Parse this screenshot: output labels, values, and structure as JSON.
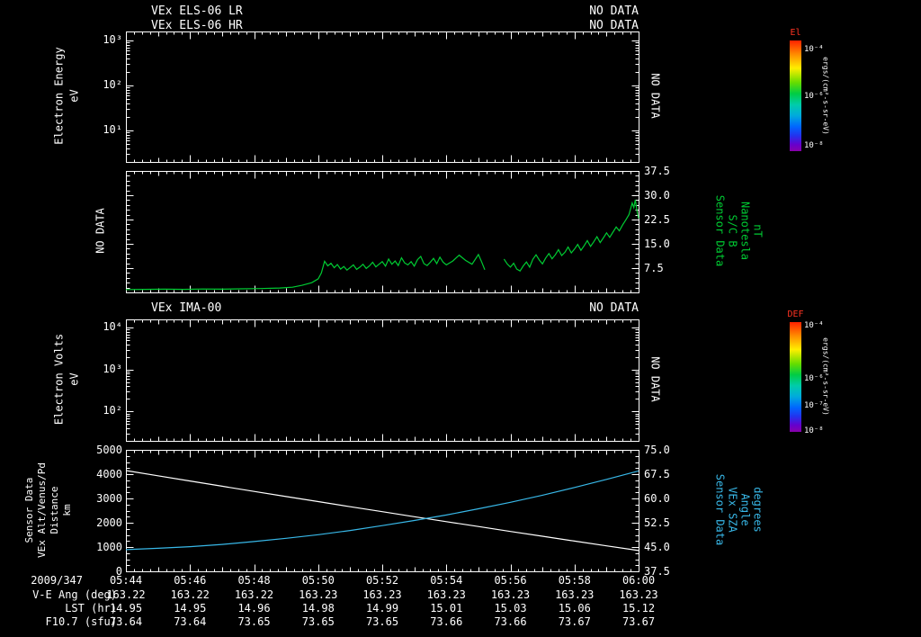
{
  "colors": {
    "background": "#000000",
    "axis": "#ffffff",
    "mag_line": "#00cc33",
    "alt_line": "#ffffff",
    "sza_line": "#38b8e8",
    "green_label": "#00cc33",
    "cyan_label": "#38b8e8",
    "colorbar_title": "#ff3322"
  },
  "panels": {
    "els": {
      "title_lr": "VEx ELS-06 LR",
      "no_data_lr": "NO DATA",
      "title_hr": "VEx ELS-06 HR",
      "no_data_hr": "NO DATA",
      "ylabel_line1": "Electron Energy",
      "ylabel_line2": "eV",
      "yticks": [
        "10³",
        "10²",
        "10¹"
      ],
      "right_label": "NO DATA"
    },
    "mag": {
      "left_label": "NO DATA",
      "yticks_right": [
        "37.5",
        "30.0",
        "22.5",
        "15.0",
        "7.5"
      ],
      "right_label_lines": [
        "Sensor Data",
        "S/C B",
        "Nanotesla",
        "nT"
      ]
    },
    "ima": {
      "title": "VEx IMA-00",
      "no_data": "NO DATA",
      "ylabel_line1": "Electron Volts",
      "ylabel_line2": "eV",
      "yticks": [
        "10⁴",
        "10³",
        "10²"
      ],
      "right_label": "NO DATA"
    },
    "alt": {
      "left_label_lines": [
        "Sensor Data",
        "VEx Alt/Venus/Pd",
        "Distance",
        "km"
      ],
      "yticks_left": [
        "5000",
        "4000",
        "3000",
        "2000",
        "1000",
        "0"
      ],
      "yticks_right": [
        "75.0",
        "67.5",
        "60.0",
        "52.5",
        "45.0",
        "37.5"
      ],
      "right_label_lines": [
        "Sensor Data",
        "VEx SZA",
        "Angle",
        "degrees"
      ]
    }
  },
  "xaxis": {
    "date": "2009/347",
    "ticks": [
      "05:44",
      "05:46",
      "05:48",
      "05:50",
      "05:52",
      "05:54",
      "05:56",
      "05:58",
      "06:00"
    ]
  },
  "table": {
    "rows": [
      {
        "label": "V-E Ang (deg)",
        "values": [
          "163.22",
          "163.22",
          "163.22",
          "163.23",
          "163.23",
          "163.23",
          "163.23",
          "163.23",
          "163.23"
        ]
      },
      {
        "label": "LST (hr)",
        "values": [
          "14.95",
          "14.95",
          "14.96",
          "14.98",
          "14.99",
          "15.01",
          "15.03",
          "15.06",
          "15.12"
        ]
      },
      {
        "label": "F10.7 (sfu)",
        "values": [
          "73.64",
          "73.64",
          "73.65",
          "73.65",
          "73.65",
          "73.66",
          "73.66",
          "73.67",
          "73.67"
        ]
      }
    ]
  },
  "colorbars": [
    {
      "title": "El",
      "labels": [
        "10⁻⁴",
        "10⁻⁶",
        "10⁻⁸"
      ],
      "positions": [
        0.08,
        0.5,
        0.95
      ],
      "unit": "ergs/(cm²-s-sr-eV)"
    },
    {
      "title": "DEF",
      "labels": [
        "10⁻⁴",
        "10⁻⁶",
        "10⁻⁷",
        "10⁻⁸"
      ],
      "positions": [
        0.03,
        0.52,
        0.76,
        0.99
      ],
      "unit": "ergs/(cm²-s-sr-eV)"
    }
  ],
  "chart_data": [
    {
      "panel": "els_electron_energy",
      "type": "heatmap",
      "title": "VEx ELS-06 LR / VEx ELS-06 HR",
      "ylabel": "Electron Energy (eV)",
      "yscale": "log",
      "ytick_values": [
        10,
        100,
        1000
      ],
      "status": "NO DATA",
      "values": []
    },
    {
      "panel": "magnetic_field",
      "type": "line",
      "name": "Sensor Data S/C B Nanotesla (nT)",
      "color": "#00cc33",
      "ylim": [
        0,
        37.5
      ],
      "ytick_values": [
        7.5,
        15.0,
        22.5,
        30.0,
        37.5
      ],
      "x_unit": "minutes after 05:44 (2009/347)",
      "xlim": [
        0,
        16
      ],
      "segments": [
        [
          [
            0,
            0.9
          ],
          [
            0.6,
            0.95
          ],
          [
            1.2,
            1.0
          ],
          [
            1.8,
            0.95
          ],
          [
            2.4,
            1.05
          ],
          [
            3.0,
            1.0
          ],
          [
            3.6,
            1.1
          ],
          [
            4.2,
            1.2
          ],
          [
            4.8,
            1.35
          ],
          [
            5.2,
            1.6
          ],
          [
            5.5,
            2.2
          ],
          [
            5.8,
            3.0
          ],
          [
            6.0,
            4.2
          ],
          [
            6.1,
            6.0
          ],
          [
            6.2,
            9.6
          ],
          [
            6.3,
            8.2
          ],
          [
            6.4,
            9.0
          ],
          [
            6.5,
            7.6
          ],
          [
            6.6,
            8.6
          ],
          [
            6.7,
            7.2
          ],
          [
            6.8,
            8.0
          ],
          [
            6.9,
            6.9
          ],
          [
            7.0,
            7.7
          ],
          [
            7.1,
            8.5
          ],
          [
            7.2,
            7.1
          ],
          [
            7.3,
            7.8
          ],
          [
            7.4,
            8.7
          ],
          [
            7.5,
            7.4
          ],
          [
            7.6,
            8.2
          ],
          [
            7.7,
            9.3
          ],
          [
            7.8,
            7.9
          ],
          [
            7.9,
            8.7
          ],
          [
            8.0,
            9.5
          ],
          [
            8.1,
            8.1
          ],
          [
            8.2,
            10.3
          ],
          [
            8.3,
            8.7
          ],
          [
            8.4,
            9.7
          ],
          [
            8.5,
            8.3
          ],
          [
            8.6,
            10.7
          ],
          [
            8.7,
            9.1
          ],
          [
            8.8,
            8.5
          ],
          [
            8.9,
            9.5
          ],
          [
            9.0,
            8.1
          ],
          [
            9.1,
            10.1
          ],
          [
            9.2,
            11.1
          ],
          [
            9.3,
            8.9
          ],
          [
            9.4,
            8.3
          ],
          [
            9.5,
            9.3
          ],
          [
            9.6,
            10.5
          ],
          [
            9.7,
            8.9
          ],
          [
            9.8,
            10.9
          ],
          [
            9.9,
            9.3
          ],
          [
            10.0,
            8.5
          ],
          [
            10.2,
            9.7
          ],
          [
            10.4,
            11.5
          ],
          [
            10.6,
            9.9
          ],
          [
            10.8,
            8.7
          ],
          [
            11.0,
            11.7
          ],
          [
            11.1,
            9.5
          ],
          [
            11.2,
            7.0
          ]
        ],
        [
          [
            11.8,
            10.3
          ],
          [
            11.9,
            8.8
          ],
          [
            12.0,
            7.8
          ],
          [
            12.1,
            9.0
          ],
          [
            12.2,
            7.2
          ],
          [
            12.3,
            6.6
          ],
          [
            12.4,
            8.2
          ],
          [
            12.5,
            9.4
          ],
          [
            12.6,
            7.8
          ],
          [
            12.7,
            10.2
          ],
          [
            12.8,
            11.6
          ],
          [
            12.9,
            10.0
          ],
          [
            13.0,
            8.8
          ],
          [
            13.1,
            10.6
          ],
          [
            13.2,
            12.0
          ],
          [
            13.3,
            10.4
          ],
          [
            13.4,
            11.6
          ],
          [
            13.5,
            13.2
          ],
          [
            13.6,
            11.4
          ],
          [
            13.7,
            12.4
          ],
          [
            13.8,
            14.0
          ],
          [
            13.9,
            12.2
          ],
          [
            14.0,
            13.4
          ],
          [
            14.1,
            14.8
          ],
          [
            14.2,
            13.0
          ],
          [
            14.3,
            14.4
          ],
          [
            14.4,
            16.0
          ],
          [
            14.5,
            14.2
          ],
          [
            14.6,
            15.6
          ],
          [
            14.7,
            17.2
          ],
          [
            14.8,
            15.4
          ],
          [
            14.9,
            16.8
          ],
          [
            15.0,
            18.4
          ],
          [
            15.1,
            17.0
          ],
          [
            15.2,
            18.6
          ],
          [
            15.3,
            20.2
          ],
          [
            15.4,
            19.0
          ],
          [
            15.5,
            20.8
          ],
          [
            15.6,
            22.4
          ],
          [
            15.7,
            24.0
          ],
          [
            15.8,
            27.6
          ],
          [
            15.85,
            26.2
          ],
          [
            15.9,
            28.6
          ],
          [
            15.95,
            25.2
          ],
          [
            16.0,
            22.8
          ]
        ]
      ]
    },
    {
      "panel": "ima_electron_volts",
      "type": "heatmap",
      "title": "VEx IMA-00",
      "ylabel": "Electron Volts (eV)",
      "yscale": "log",
      "ytick_values": [
        100,
        1000,
        10000
      ],
      "status": "NO DATA",
      "values": []
    },
    {
      "panel": "altitude_sza",
      "type": "line",
      "x_unit": "minutes after 05:44 (2009/347)",
      "xlim": [
        0,
        16
      ],
      "series": [
        {
          "name": "VEx Alt/Venus/Pd Distance (km)",
          "axis": "left",
          "color": "#ffffff",
          "ylim": [
            0,
            5000
          ],
          "points": [
            [
              0,
              4150
            ],
            [
              1,
              3933
            ],
            [
              2,
              3717
            ],
            [
              3,
              3503
            ],
            [
              4,
              3290
            ],
            [
              5,
              3079
            ],
            [
              6,
              2869
            ],
            [
              7,
              2661
            ],
            [
              8,
              2454
            ],
            [
              9,
              2249
            ],
            [
              10,
              2045
            ],
            [
              11,
              1843
            ],
            [
              12,
              1642
            ],
            [
              13,
              1443
            ],
            [
              14,
              1245
            ],
            [
              15,
              1049
            ],
            [
              16,
              854
            ]
          ]
        },
        {
          "name": "VEx SZA Angle (degrees)",
          "axis": "right",
          "color": "#38b8e8",
          "ylim": [
            37.5,
            75.0
          ],
          "points": [
            [
              0,
              44.2
            ],
            [
              1,
              44.6
            ],
            [
              2,
              45.1
            ],
            [
              3,
              45.8
            ],
            [
              4,
              46.7
            ],
            [
              5,
              47.7
            ],
            [
              6,
              48.8
            ],
            [
              7,
              50.1
            ],
            [
              8,
              51.6
            ],
            [
              9,
              53.2
            ],
            [
              10,
              54.9
            ],
            [
              11,
              56.8
            ],
            [
              12,
              58.8
            ],
            [
              13,
              61.0
            ],
            [
              14,
              63.4
            ],
            [
              15,
              65.9
            ],
            [
              16,
              68.5
            ]
          ]
        }
      ]
    }
  ]
}
